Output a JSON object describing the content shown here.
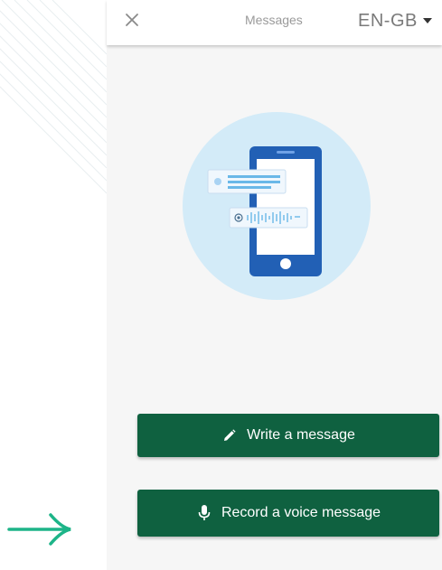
{
  "header": {
    "title": "Messages",
    "language": "EN-GB"
  },
  "actions": {
    "write_label": "Write a message",
    "record_label": "Record a voice message"
  },
  "colors": {
    "primary": "#0f6140",
    "arrow": "#1db488",
    "illustration_bg": "#d3ebf8",
    "phone": "#2260b5"
  }
}
